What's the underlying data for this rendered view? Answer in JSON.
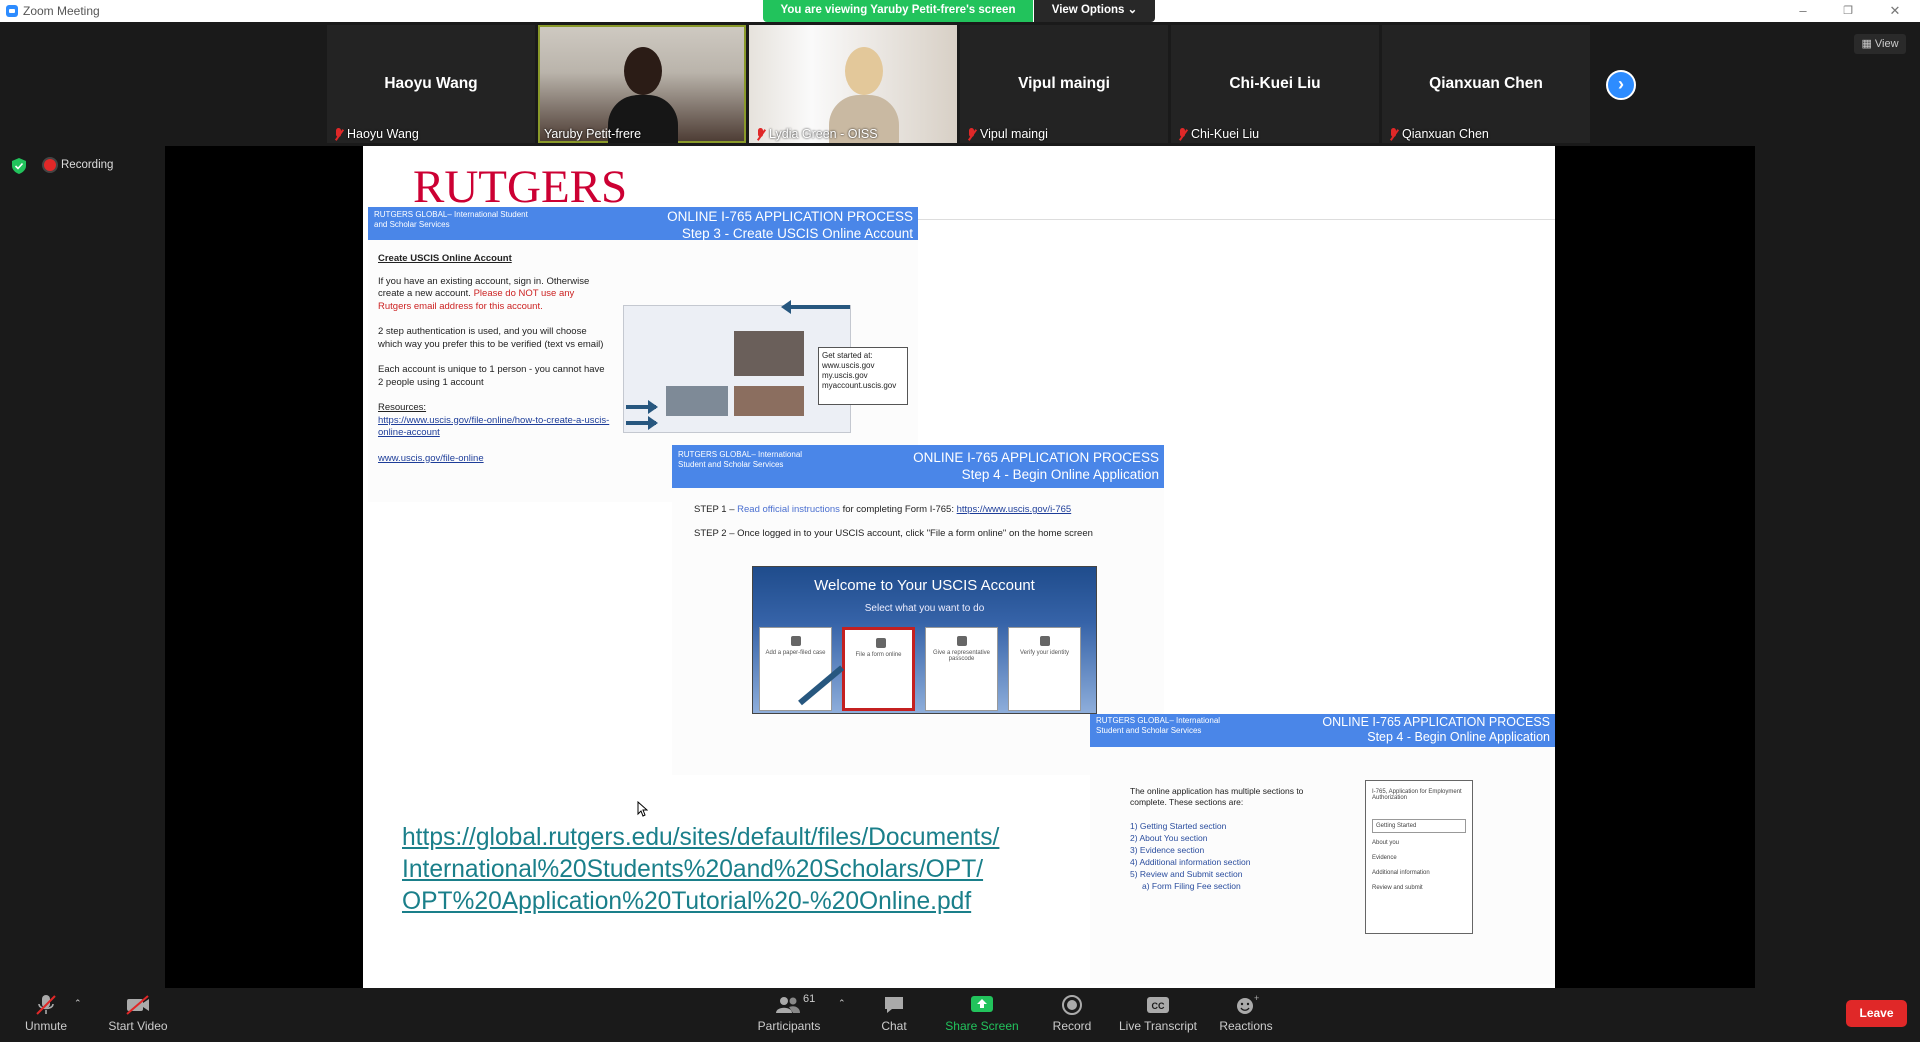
{
  "window": {
    "title": "Zoom Meeting"
  },
  "banner": {
    "viewing": "You are viewing Yaruby Petit-frere's screen",
    "view_options": "View Options"
  },
  "top_right": {
    "view": "View"
  },
  "participants_strip": [
    {
      "big": "Haoyu Wang",
      "label": "Haoyu Wang",
      "video": false
    },
    {
      "big": "",
      "label": "Yaruby Petit-frere",
      "video": true
    },
    {
      "big": "",
      "label": "Lydia Green - OISS",
      "video": true
    },
    {
      "big": "Vipul maingi",
      "label": "Vipul maingi",
      "video": false
    },
    {
      "big": "Chi-Kuei Liu",
      "label": "Chi-Kuei Liu",
      "video": false
    },
    {
      "big": "Qianxuan Chen",
      "label": "Qianxuan Chen",
      "video": false
    }
  ],
  "status": {
    "recording": "Recording"
  },
  "slide": {
    "logo": "RUTGERS",
    "panel1": {
      "head_left": "RUTGERS GLOBAL– International Student and Scholar Services",
      "head_right_1": "ONLINE I-765 APPLICATION PROCESS",
      "head_right_2": "Step 3 - Create USCIS Online Account",
      "subtitle": "Create USCIS Online Account",
      "p1": "If you have an existing account, sign in. Otherwise create a new account.",
      "p1_red": "Please do NOT use any Rutgers email address for this account.",
      "p2": "2 step authentication is used, and you will choose which way you prefer this to be verified (text vs email)",
      "p3": "Each account is unique to 1 person - you cannot have 2 people using 1 account",
      "resources": "Resources:",
      "link1": "https://www.uscis.gov/file-online/how-to-create-a-uscis-online-account",
      "link2": "www.uscis.gov/file-online",
      "box_title": "Get started at:",
      "box_items": [
        "www.uscis.gov",
        "my.uscis.gov",
        "myaccount.uscis.gov"
      ]
    },
    "panel2": {
      "head_left": "RUTGERS GLOBAL– International Student and Scholar Services",
      "head_right_1": "ONLINE I-765 APPLICATION PROCESS",
      "head_right_2": "Step 4 - Begin Online Application",
      "step1": "STEP 1 –",
      "step1_red": "Read official instructions",
      "step1_rest": "for completing Form I-765:",
      "step1_link": "https://www.uscis.gov/i-765",
      "step2": "STEP 2 – Once logged in to your USCIS account, click \"File a form online\" on the home screen",
      "uscis_title": "Welcome to Your USCIS Account",
      "uscis_sub": "Select what you want to do",
      "cards": [
        "Add a paper-filed case",
        "File a form online",
        "Give a representative passcode",
        "Verify your identity"
      ]
    },
    "panel3": {
      "head_left": "RUTGERS GLOBAL– International Student and Scholar Services",
      "head_right_1": "ONLINE I-765 APPLICATION PROCESS",
      "head_right_2": "Step 4 - Begin Online Application",
      "intro": "The online application has multiple sections to complete. These sections are:",
      "items": [
        "1)   Getting Started section",
        "2)   About You section",
        "3)   Evidence section",
        "4)   Additional information section",
        "5)   Review and Submit section",
        "     a)   Form Filing Fee section"
      ],
      "side_title": "I-765, Application for Employment Authorization",
      "side_items": [
        "Getting Started",
        "About you",
        "Evidence",
        "Additional information",
        "Review and submit"
      ]
    },
    "big_link": "https://global.rutgers.edu/sites/default/files/Documents/International%20Students%20and%20Scholars/OPT/OPT%20Application%20Tutorial%20-%20Online.pdf"
  },
  "toolbar": {
    "unmute": "Unmute",
    "start_video": "Start Video",
    "participants": "Participants",
    "participants_count": "61",
    "chat": "Chat",
    "share_screen": "Share Screen",
    "record": "Record",
    "live_transcript": "Live Transcript",
    "reactions": "Reactions",
    "leave": "Leave"
  },
  "colors": {
    "zoom_blue": "#2d8cff",
    "green": "#22c35c",
    "leave_red": "#e02828",
    "rutgers_red": "#cc0033"
  }
}
